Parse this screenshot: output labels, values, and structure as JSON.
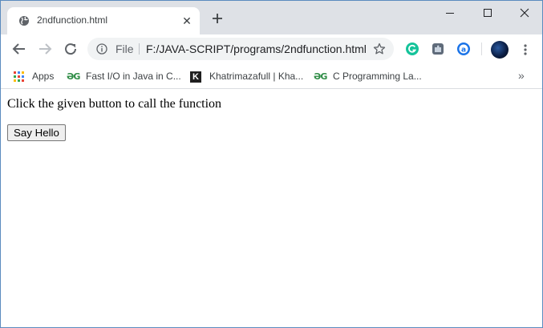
{
  "tab": {
    "title": "2ndfunction.html",
    "close_glyph": "✕",
    "favicon": "globe-icon"
  },
  "window_controls": {
    "minimize": "minimize-icon",
    "maximize": "maximize-icon",
    "close": "close-icon"
  },
  "toolbar": {
    "file_label": "File",
    "url": "F:/JAVA-SCRIPT/programs/2ndfunction.html",
    "extensions": [
      "grammarly-icon",
      "extension-puzzle-icon",
      "a-extension-icon"
    ]
  },
  "bookmarks": [
    {
      "label": "Apps",
      "icon": "apps-grid-icon"
    },
    {
      "label": "Fast I/O in Java in C...",
      "icon": "gfg-icon",
      "icon_text": "ƏG"
    },
    {
      "label": "Khatrimazafull | Kha...",
      "icon": "k-logo-icon",
      "icon_text": "K"
    },
    {
      "label": "C Programming La...",
      "icon": "gfg-icon",
      "icon_text": "ƏG"
    }
  ],
  "bookmarks_more": "»",
  "page": {
    "text": "Click the given button to call the function",
    "button_label": "Say Hello"
  },
  "colors": {
    "tabstrip": "#dee1e6",
    "omnibox": "#f1f3f4",
    "grammarly": "#15c39a",
    "gfg_green": "#2f8d46",
    "a_ext_blue": "#1a73e8",
    "window_border": "#5b8bbf"
  }
}
